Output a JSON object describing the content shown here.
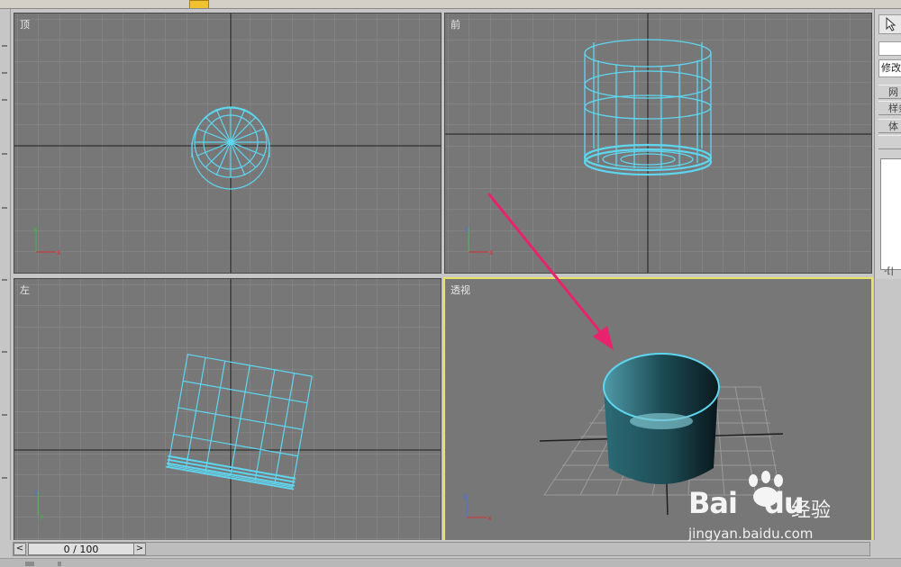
{
  "viewports": {
    "top": {
      "label": "顶"
    },
    "front": {
      "label": "前"
    },
    "left": {
      "label": "左"
    },
    "perspective": {
      "label": "透视"
    }
  },
  "command_panel": {
    "modify_tab": "修改",
    "rollout_buttons": [
      "网",
      "样条",
      "体"
    ],
    "ellipsis": "-[|"
  },
  "time_slider": {
    "position_text": "0 / 100",
    "prev_icon": "left-arrow-icon",
    "next_icon": "right-arrow-icon"
  },
  "watermark": {
    "brand": "Bai",
    "brand_suffix": "du",
    "cn": "经验",
    "url": "jingyan.baidu.com"
  },
  "colors": {
    "viewport_bg": "#777777",
    "grid": "#8c8c8c",
    "wireframe": "#5fd6f0",
    "active_border": "#e9e36a",
    "annotation_arrow": "#e8236e",
    "cylinder_shade": "#1f5560"
  },
  "icons": [
    "select-arrow-icon",
    "axis-tripod-icon",
    "annotation-arrow-icon",
    "paw-icon"
  ]
}
